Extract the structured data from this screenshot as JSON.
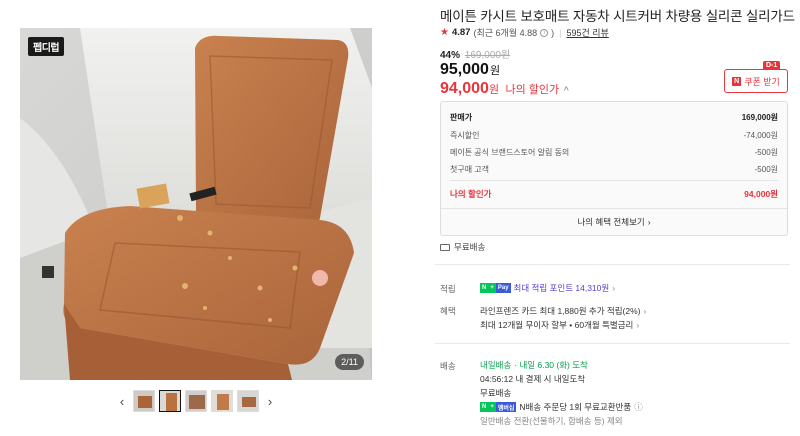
{
  "gallery": {
    "brand_logo_text": "펩디럽",
    "counter": "2/11",
    "prev": "‹",
    "next": "›",
    "thumb_count": 5,
    "active_thumb": 2
  },
  "product": {
    "title": "메이튼 카시트 보호매트 자동차 시트커버 차량용 실리콘 실리가드",
    "rating": {
      "score": "4.87",
      "recent": "(최근 6개월 4.88",
      "recent_close": ")",
      "reviews": "595건 리뷰"
    },
    "discount_pct": "44%",
    "original_price": "169,000원",
    "price": "95,000",
    "price_unit": "원",
    "my_price": "94,000",
    "my_price_unit": "원",
    "my_price_label": "나의 할인가",
    "coupon": {
      "dday": "D-1",
      "n": "N",
      "label": "쿠폰 받기"
    }
  },
  "breakdown": {
    "rows": [
      {
        "label": "판매가",
        "value": "169,000원"
      },
      {
        "label": "즉시할인",
        "value": "-74,000원"
      },
      {
        "label": "메이튼 공식 브랜드스토어 알림 동의",
        "value": "-500원"
      },
      {
        "label": "첫구매 고객",
        "value": "-500원"
      }
    ],
    "mine": {
      "label": "나의 할인가",
      "value": "94,000원"
    },
    "view_all": "나의 혜택 전체보기",
    "view_all_caret": "›"
  },
  "shipping_free": "무료배송",
  "points": {
    "label": "적립",
    "text": "최대 적립 포인트 14,310원",
    "caret": "›",
    "badge_n": "N",
    "badge_plus": "+",
    "badge_pay": "Pay"
  },
  "benefits": {
    "label": "혜택",
    "line1": "라인프렌즈 카드 최대 1,880원 추가 적립(2%)",
    "line2": "최대 12개월 무이자 할부 • 60개월 특별금리",
    "caret": "›"
  },
  "delivery": {
    "label": "배송",
    "tomorrow_badge": "내일배송",
    "tomorrow_text": "· 내일 6.30 (화) 도착",
    "cutoff": "04:56:12  내 결제 시 내일도착",
    "free": "무료배송",
    "return_text": "N배송 주문당 1회 무료교환반품",
    "return_badge_n": "N",
    "return_badge_plus": "+",
    "return_badge_pay": "멤버십",
    "normal": "일반배송 전환(선물하기, 합배송 등) 제외"
  },
  "colors": {
    "accent": "#e8343c",
    "naver_green": "#03c75a",
    "points_purple": "#5b3bd6"
  }
}
